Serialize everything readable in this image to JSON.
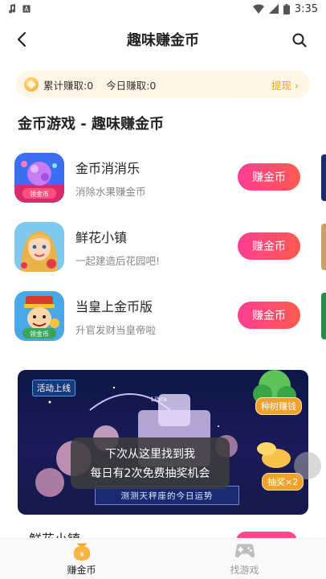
{
  "status_bar": {
    "time": "3:35"
  },
  "header": {
    "title": "趣味赚金币"
  },
  "earnings": {
    "total_label": "累计赚取:0",
    "today_label": "今日赚取:0",
    "withdraw_label": "提现 ›"
  },
  "section": {
    "title": "金币游戏 - 趣味赚金币"
  },
  "games": [
    {
      "name": "金币消消乐",
      "desc": "消除水果赚金币",
      "button": "赚金币",
      "icon_tag": "领金币"
    },
    {
      "name": "鲜花小镇",
      "desc": "一起建造后花园吧!",
      "button": "赚金币"
    },
    {
      "name": "当皇上金币版",
      "desc": "升官发财当皇帝啦",
      "button": "赚金币",
      "icon_tag": "领金币"
    }
  ],
  "banner": {
    "tag": "活动上线",
    "badge_tree": "种树赚钱",
    "badge_lottery": "抽奖×2",
    "bottom_text": "测测天秤座的今日运势",
    "libra_label": "Libra"
  },
  "toast": {
    "line1": "下次从这里找到我",
    "line2": "每日有2次免费抽奖机会"
  },
  "peek_card": {
    "name": "鲜花小镇"
  },
  "tabbar": {
    "tabs": [
      {
        "label": "赚金币",
        "icon": "coin-bag-icon",
        "active": true
      },
      {
        "label": "找游戏",
        "icon": "gamepad-icon",
        "active": false
      }
    ]
  },
  "colors": {
    "accent": "#ff3e93",
    "gold": "#f2a62b"
  }
}
